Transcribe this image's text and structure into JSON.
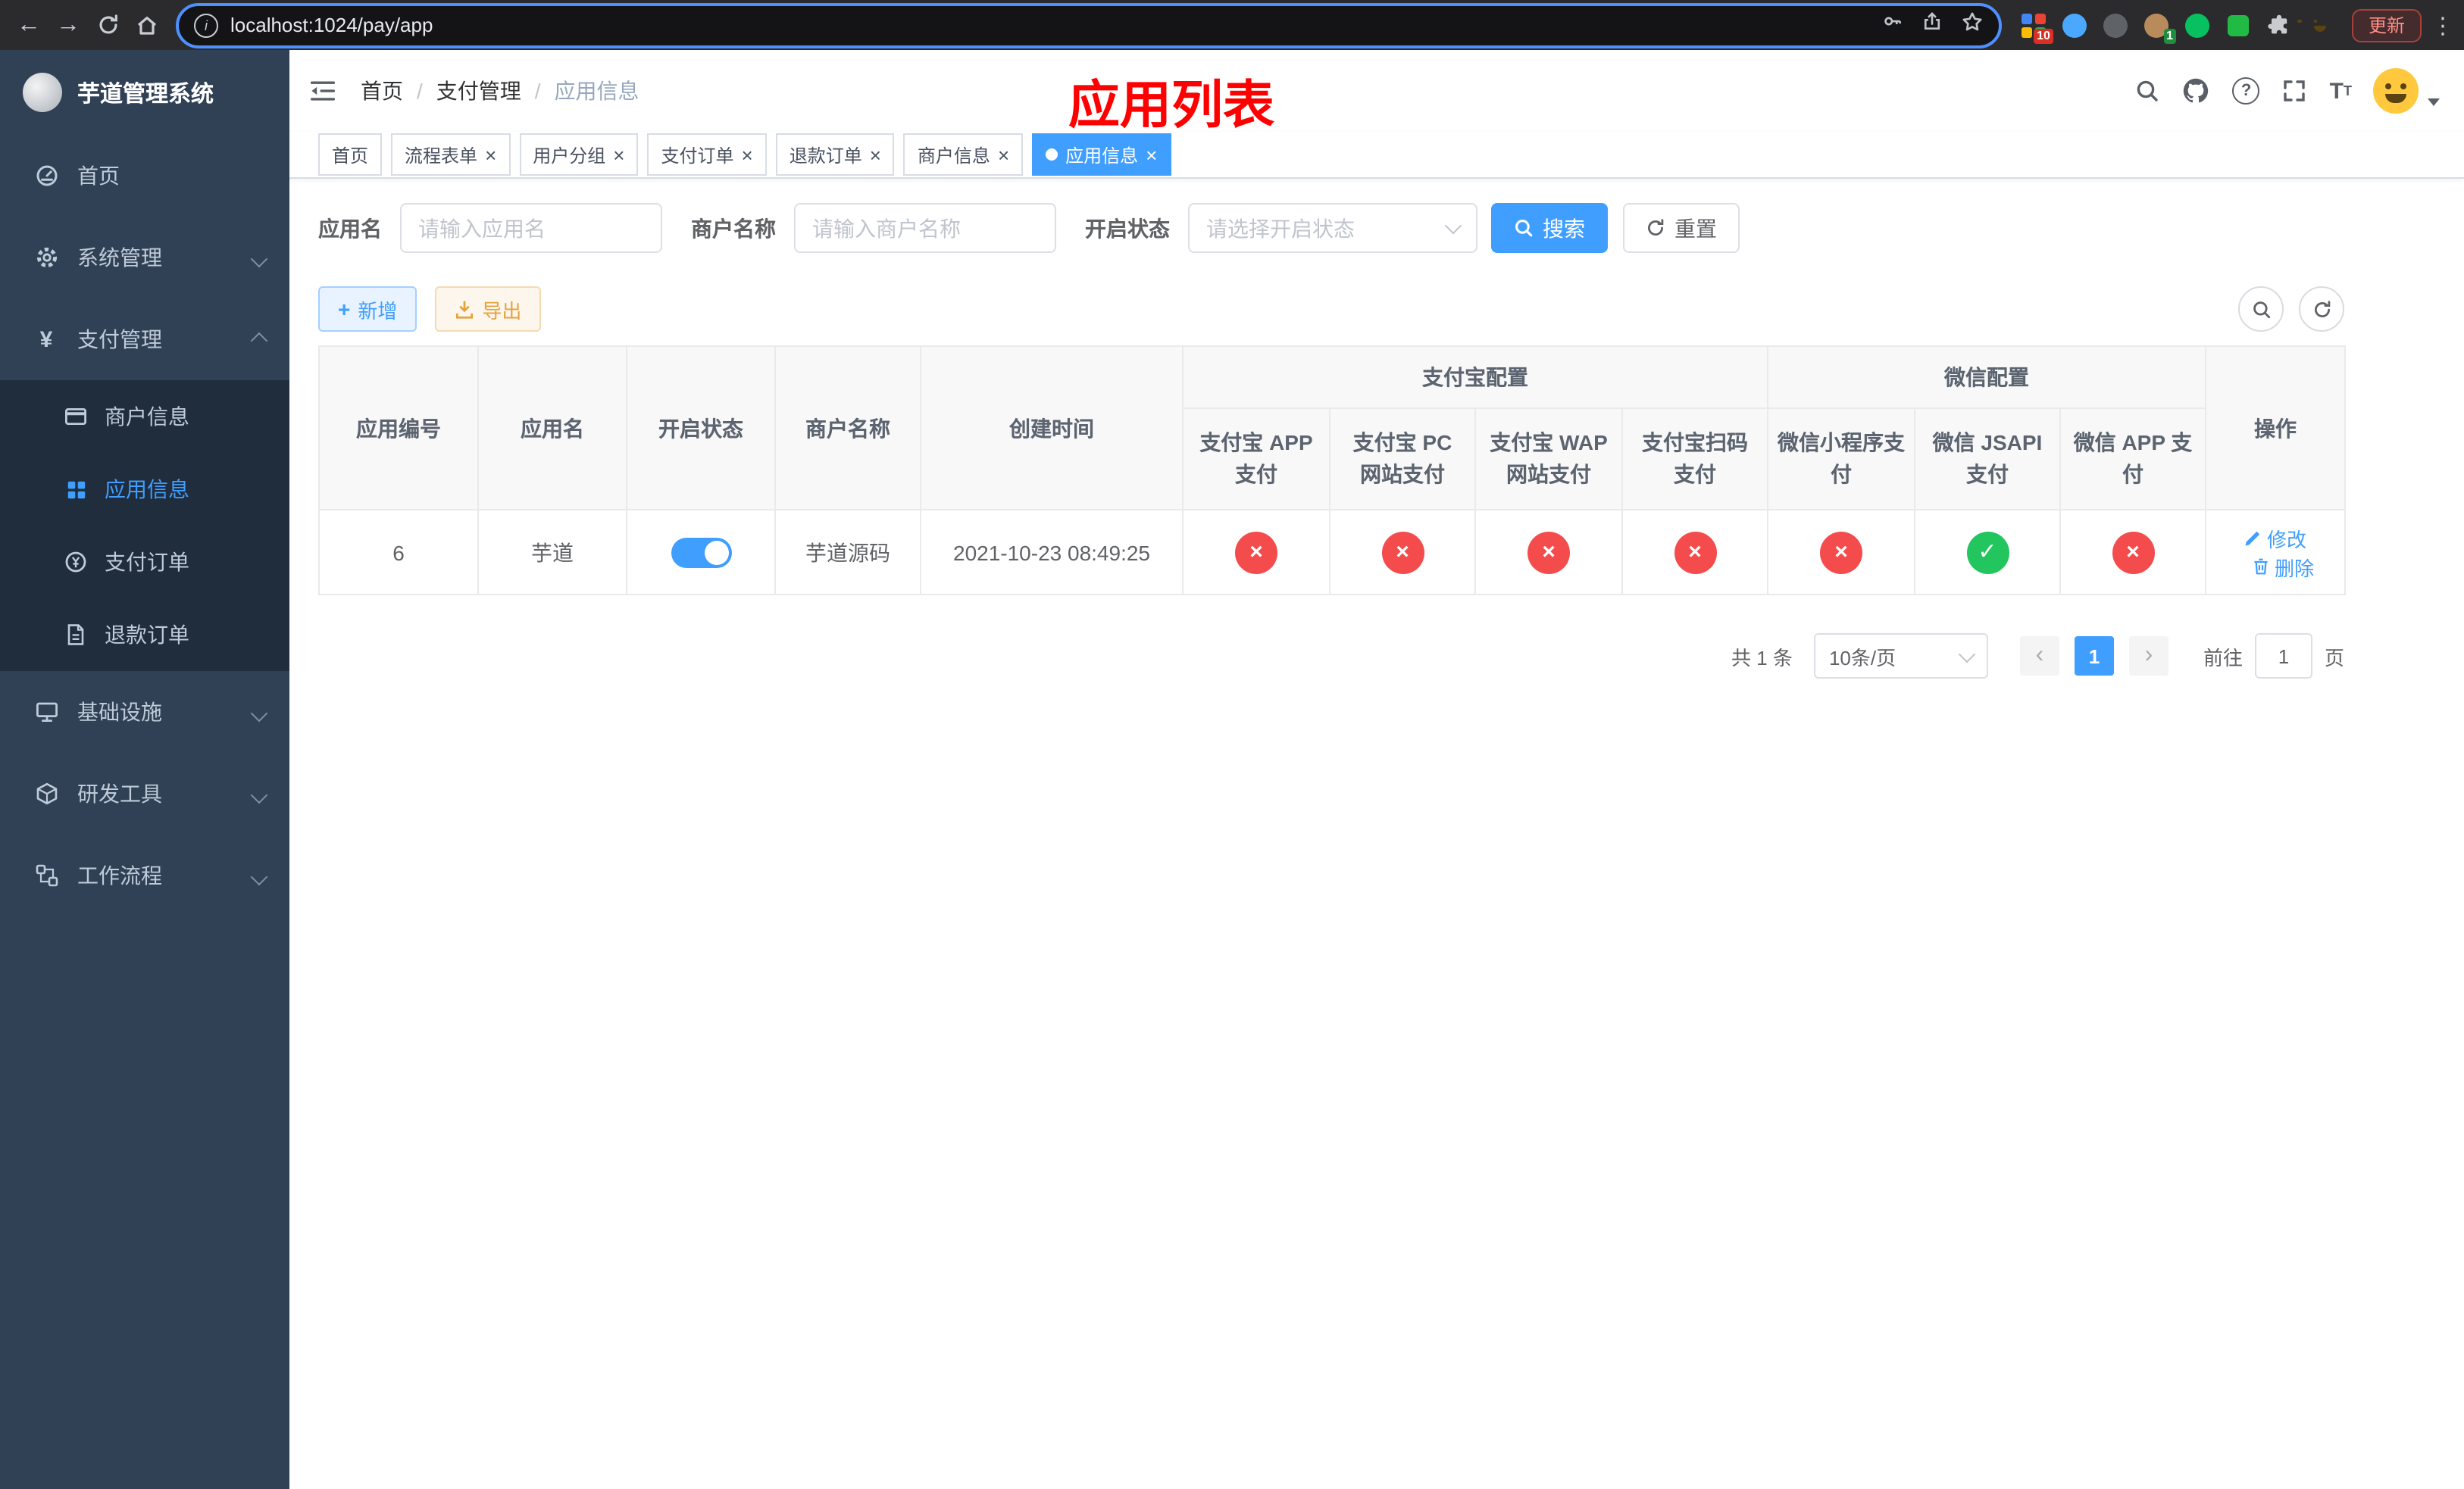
{
  "browser": {
    "url": "localhost:1024/pay/app",
    "update_label": "更新",
    "extensions_badge": "10",
    "profile_badge": "1"
  },
  "sidebar": {
    "logo_title": "芋道管理系统",
    "items": [
      {
        "label": "首页"
      },
      {
        "label": "系统管理"
      },
      {
        "label": "支付管理"
      },
      {
        "label": "商户信息"
      },
      {
        "label": "应用信息"
      },
      {
        "label": "支付订单"
      },
      {
        "label": "退款订单"
      },
      {
        "label": "基础设施"
      },
      {
        "label": "研发工具"
      },
      {
        "label": "工作流程"
      }
    ]
  },
  "navbar": {
    "breadcrumb": [
      "首页",
      "支付管理",
      "应用信息"
    ],
    "banner": "应用列表"
  },
  "tabs": [
    {
      "label": "首页"
    },
    {
      "label": "流程表单"
    },
    {
      "label": "用户分组"
    },
    {
      "label": "支付订单"
    },
    {
      "label": "退款订单"
    },
    {
      "label": "商户信息"
    },
    {
      "label": "应用信息"
    }
  ],
  "filters": {
    "app_name_label": "应用名",
    "app_name_placeholder": "请输入应用名",
    "merchant_label": "商户名称",
    "merchant_placeholder": "请输入商户名称",
    "status_label": "开启状态",
    "status_placeholder": "请选择开启状态",
    "search_label": "搜索",
    "reset_label": "重置"
  },
  "toolbar": {
    "add_label": "新增",
    "export_label": "导出"
  },
  "table": {
    "headers": {
      "app_id": "应用编号",
      "app_name": "应用名",
      "status": "开启状态",
      "merchant": "商户名称",
      "created": "创建时间",
      "alipay_group": "支付宝配置",
      "wechat_group": "微信配置",
      "alipay_app": "支付宝 APP 支付",
      "alipay_pc": "支付宝 PC 网站支付",
      "alipay_wap": "支付宝 WAP 网站支付",
      "alipay_qr": "支付宝扫码支付",
      "wechat_mini": "微信小程序支付",
      "wechat_jsapi": "微信 JSAPI 支付",
      "wechat_app": "微信 APP 支付",
      "actions": "操作"
    },
    "row": {
      "app_id": "6",
      "app_name": "芋道",
      "enabled": true,
      "merchant": "芋道源码",
      "created": "2021-10-23 08:49:25",
      "alipay_app": false,
      "alipay_pc": false,
      "alipay_wap": false,
      "alipay_qr": false,
      "wechat_mini": false,
      "wechat_jsapi": true,
      "wechat_app": false,
      "edit_label": "修改",
      "delete_label": "删除"
    }
  },
  "pagination": {
    "total_label": "共 1 条",
    "page_size_label": "10条/页",
    "current_page": "1",
    "goto_label": "前往",
    "goto_value": "1",
    "page_unit": "页"
  },
  "colors": {
    "accent": "#409eff",
    "danger": "#f44c4c",
    "success": "#22c55e",
    "banner_red": "#ff0000",
    "sidebar_bg": "#304156",
    "submenu_bg": "#1f2d3d"
  }
}
